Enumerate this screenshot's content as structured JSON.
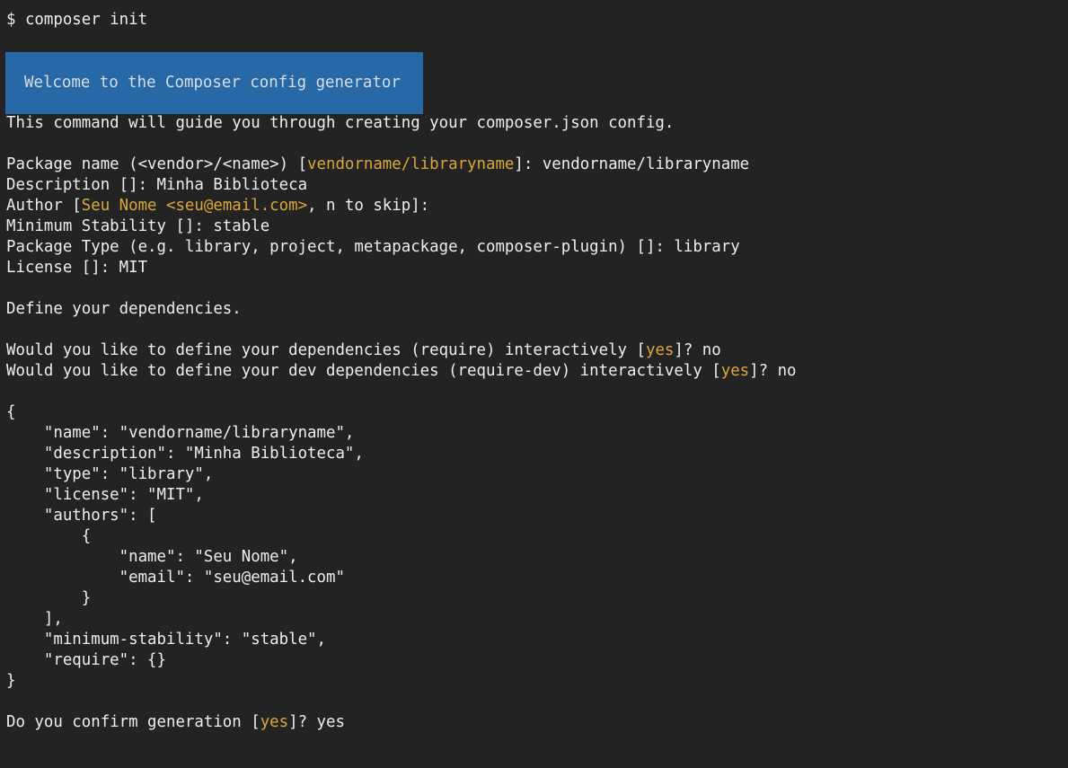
{
  "terminal": {
    "prompt_command": "$ composer init",
    "banner": "Welcome to the Composer config generator",
    "intro": "This command will guide you through creating your composer.json config.",
    "package_name": {
      "prompt": "Package name (<vendor>/<name>) [",
      "default": "vendorname/libraryname",
      "suffix": "]: ",
      "answer": "vendorname/libraryname"
    },
    "description": "Description []: Minha Biblioteca",
    "author": {
      "prompt": "Author [",
      "default": "Seu Nome <seu@email.com>",
      "suffix": ", n to skip]:"
    },
    "min_stability": "Minimum Stability []: stable",
    "package_type": "Package Type (e.g. library, project, metapackage, composer-plugin) []: library",
    "license": "License []: MIT",
    "define_deps": "Define your dependencies.",
    "require_q": {
      "prompt": "Would you like to define your dependencies (require) interactively [",
      "default": "yes",
      "suffix": "]? no"
    },
    "require_dev_q": {
      "prompt": "Would you like to define your dev dependencies (require-dev) interactively [",
      "default": "yes",
      "suffix": "]? no"
    },
    "json_lines": [
      "{",
      "    \"name\": \"vendorname/libraryname\",",
      "    \"description\": \"Minha Biblioteca\",",
      "    \"type\": \"library\",",
      "    \"license\": \"MIT\",",
      "    \"authors\": [",
      "        {",
      "            \"name\": \"Seu Nome\",",
      "            \"email\": \"seu@email.com\"",
      "        }",
      "    ],",
      "    \"minimum-stability\": \"stable\",",
      "    \"require\": {}",
      "}"
    ],
    "confirm": {
      "prompt": "Do you confirm generation [",
      "default": "yes",
      "suffix": "]? yes"
    }
  },
  "colors": {
    "background": "#232323",
    "text": "#eeeeee",
    "banner_bg": "#2769a7",
    "highlight": "#d9a83c"
  }
}
